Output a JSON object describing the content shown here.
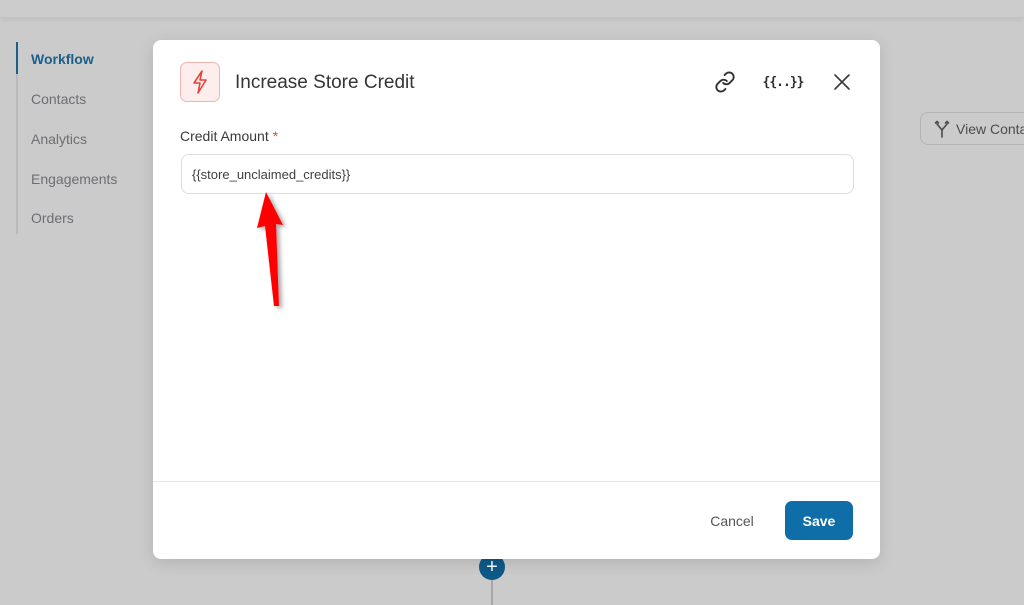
{
  "sidebar": {
    "items": [
      {
        "label": "Workflow",
        "active": true
      },
      {
        "label": "Contacts",
        "active": false
      },
      {
        "label": "Analytics",
        "active": false
      },
      {
        "label": "Engagements",
        "active": false
      },
      {
        "label": "Orders",
        "active": false
      }
    ]
  },
  "canvas": {
    "view_button_label": "View Conta",
    "view_button_icon": "branch-icon",
    "add_node_label": "+"
  },
  "modal": {
    "icon": "lightning-icon",
    "title": "Increase Store Credit",
    "header_actions": [
      {
        "name": "link-icon"
      },
      {
        "name": "merge-tags-icon",
        "label": "{{..}}"
      },
      {
        "name": "close-icon"
      }
    ],
    "field": {
      "label": "Credit Amount",
      "required_mark": "*",
      "value": "{{store_unclaimed_credits}}"
    },
    "footer": {
      "cancel_label": "Cancel",
      "save_label": "Save"
    }
  },
  "colors": {
    "primary": "#0f6ea8",
    "sidebar_active": "#1b5f8a",
    "required": "#e2453c",
    "annotation_arrow": "#ff0000",
    "icon_accent": "#e2453c"
  }
}
